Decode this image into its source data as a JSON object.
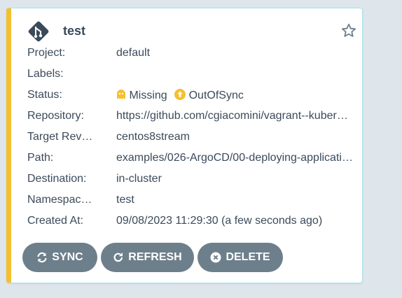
{
  "app": {
    "name": "test"
  },
  "fields": {
    "project_label": "Project:",
    "project_value": "default",
    "labels_label": "Labels:",
    "labels_value": "",
    "status_label": "Status:",
    "health_status": "Missing",
    "sync_status": "OutOfSync",
    "repository_label": "Repository:",
    "repository_value": "https://github.com/cgiacomini/vagrant--kuber…",
    "target_label": "Target Rev…",
    "target_value": "centos8stream",
    "path_label": "Path:",
    "path_value": "examples/026-ArgoCD/00-deploying-applicati…",
    "destination_label": "Destination:",
    "destination_value": "in-cluster",
    "namespace_label": "Namespac…",
    "namespace_value": "test",
    "created_label": "Created At:",
    "created_value": "09/08/2023 11:29:30  (a few seconds ago)"
  },
  "actions": {
    "sync_label": "SYNC",
    "refresh_label": "REFRESH",
    "delete_label": "DELETE"
  },
  "icons": {
    "logo": "git-diamond-icon",
    "favorite": "star-outline-icon",
    "health": "ghost-icon",
    "sync_status": "arrow-up-circle-icon",
    "sync": "sync-icon",
    "refresh": "refresh-icon",
    "delete": "close-circle-icon"
  },
  "colors": {
    "accent_bar": "#f4c030",
    "status_warning": "#f4c030",
    "button_bg": "#6d7f8b",
    "text": "#3b4a5a",
    "card_border": "#a8e2e8"
  }
}
